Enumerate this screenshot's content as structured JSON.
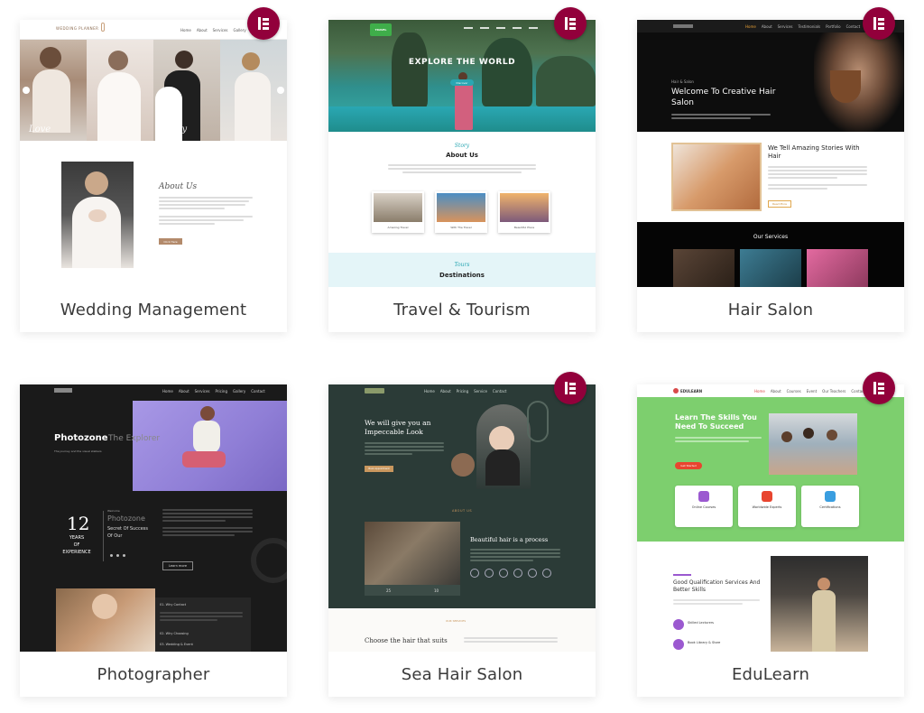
{
  "cards": [
    {
      "label": "Wedding Management",
      "screenshot": {
        "logo": "WEDDING PLANNER",
        "nav": [
          "Home",
          "About",
          "Services",
          "Gallery",
          "Contact"
        ],
        "hero_script_left": "Love",
        "hero_script_right": "Happy",
        "section_title": "About Us",
        "button": "Click Here"
      }
    },
    {
      "label": "Travel & Tourism",
      "screenshot": {
        "logo": "TRAVEL",
        "hero_title": "EXPLORE THE WORLD",
        "hero_button": "Discover",
        "script_label": "Story",
        "section_title": "About Us",
        "photo_captions": [
          "Amazing Travel",
          "With The Travel",
          "Beautiful Place"
        ],
        "script_label_2": "Tours",
        "section_title_2": "Destinations"
      }
    },
    {
      "label": "Hair Salon",
      "screenshot": {
        "nav": [
          "Home",
          "About",
          "Services",
          "Testimonials",
          "Portfolio",
          "Contact"
        ],
        "hero_small": "Hair & Salon",
        "hero_title": "Welcome To Creative Hair Salon",
        "story_title": "We Tell Amazing Stories With Hair",
        "button": "Read More",
        "services_title": "Our Services"
      }
    },
    {
      "label": "Photographer",
      "screenshot": {
        "nav": [
          "Home",
          "About",
          "Services",
          "Pricing",
          "Gallery",
          "Contact"
        ],
        "hero_title": "Photozone",
        "hero_sub": "The Explorer",
        "hero_tag": "The journey and the visual stalkers",
        "years_number": "12",
        "years_text": [
          "YEARS",
          "OF",
          "EXPERIENCE"
        ],
        "welcome": "Welcome",
        "brand": "Photozone",
        "brand_sub": "Secret Of Success Of Our",
        "button": "Learn more",
        "accordion": [
          "01. Why Contact",
          "02. Why Choosing",
          "03. Wedding & Event"
        ]
      }
    },
    {
      "label": "Sea Hair Salon",
      "screenshot": {
        "nav": [
          "Home",
          "About",
          "Pricing",
          "Service",
          "Contact"
        ],
        "hero_title": "We will give you an Impeccable Look",
        "button": "Book Appointment",
        "about_label": "ABOUT US",
        "process_title": "Beautiful hair is a process",
        "stats": [
          "25",
          "10"
        ],
        "bottom_label": "OUR SERVICES",
        "bottom_title": "Choose the hair that suits"
      }
    },
    {
      "label": "EduLearn",
      "screenshot": {
        "logo": "EDULEARN",
        "nav": [
          "Home",
          "About",
          "Courses",
          "Event",
          "Our Teachers",
          "Contact"
        ],
        "hero_title": "Learn The Skills You Need To Succeed",
        "button": "Get Started",
        "features": [
          "Online Courses",
          "Worldwide Experts",
          "Certifications"
        ],
        "qualif_title": "Good Qualification Services And Better Skills",
        "list": [
          "Skilled Lecturers",
          "Book Library & Store"
        ]
      }
    }
  ],
  "colors": {
    "elementor_badge": "#92003b",
    "wedding_accent": "#b38a6b",
    "travel_teal": "#2aa7b3",
    "salon_black": "#111111",
    "photo_purple": "#8f7ed6",
    "sea_green": "#2b3b37",
    "edu_green": "#7dcf6e"
  },
  "badge_icon": "elementor-logo-icon"
}
